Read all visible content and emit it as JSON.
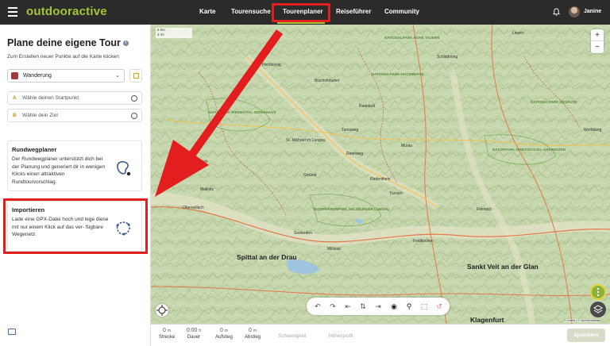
{
  "header": {
    "logo": "outdooractive",
    "nav": [
      "Karte",
      "Tourensuche",
      "Tourenplaner",
      "Reiseführer",
      "Community"
    ],
    "active_nav": "Tourenplaner",
    "username": "Janine"
  },
  "panel": {
    "title": "Plane deine eigene Tour",
    "subtitle": "Zum Erstellen neuer Punkte auf die Karte klicken",
    "activity": "Wanderung",
    "start_placeholder": "Wähle deinen Startpunkt",
    "start_letter": "A",
    "end_placeholder": "Wähle dein Ziel",
    "end_letter": "B",
    "cards": [
      {
        "title": "Rundwegplaner",
        "body": "Der Rundwegplaner unterstützt dich bei der Planung und generiert dir in wenigen Klicks einen attraktiven Rundtourvorschlag."
      },
      {
        "title": "Importieren",
        "body": "Lade eine GPX-Datei hoch und lege diese mit nur einem Klick auf das ver- fügbare Wegenetz."
      }
    ]
  },
  "map": {
    "scale_top": "5 km",
    "scale_bottom": "3 mi",
    "places_big": [
      "Spittal an der Drau",
      "Sankt Veit an der Glan",
      "Klagenfurt"
    ],
    "places": [
      "Hochkönig",
      "Bischofshofen",
      "Radstadt",
      "St. Michael im Lungau",
      "Tamsweg",
      "Murau",
      "Schladming",
      "Gmünd",
      "Seeboden",
      "Millstatt",
      "Radenthein",
      "Feldkirchen",
      "Obervellach",
      "Friesach",
      "Wolfsberg",
      "Bad Gastein",
      "Mallnitz",
      "Rennweg",
      "Turrach",
      "Liezen"
    ],
    "parks": [
      "NATIONALPARK HOHE TAUERN",
      "NATURPARK RIEDING­TAL ZEDERHAUS",
      "BIOSPHÄRENPARK SALZBURGER LUNGAU",
      "NATIONALPARK NOCKBERGE",
      "NATURPARK ZIRBITZKOGEL-GREBENZEN",
      "NATIONALPARK GESÄUSE"
    ],
    "attribution": "© Leaflet | © OpenStreetMap"
  },
  "stats": [
    {
      "value": "0",
      "unit": "m",
      "label": "Strecke"
    },
    {
      "value": "0:00",
      "unit": "h",
      "label": "Dauer"
    },
    {
      "value": "0",
      "unit": "m",
      "label": "Aufstieg"
    },
    {
      "value": "0",
      "unit": "m",
      "label": "Abstieg"
    },
    {
      "value": "",
      "unit": "",
      "label": "Schwierigkeit"
    },
    {
      "value": "",
      "unit": "",
      "label": "Höhenprofil"
    }
  ],
  "save_label": "Speichern",
  "colors": {
    "accent": "#a4c636",
    "highlight_red": "#e31e1e",
    "header_bg": "#2b2b2b"
  }
}
